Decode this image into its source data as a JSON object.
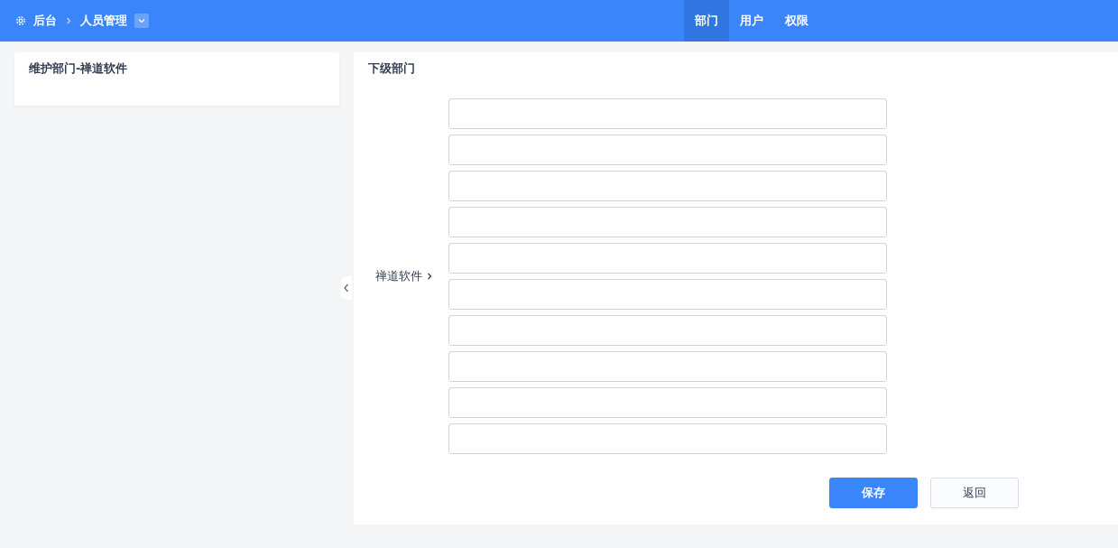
{
  "header": {
    "breadcrumb": [
      {
        "label": "后台"
      },
      {
        "label": "人员管理"
      }
    ],
    "nav": [
      {
        "label": "部门",
        "selected": true
      },
      {
        "label": "用户",
        "selected": false
      },
      {
        "label": "权限",
        "selected": false
      }
    ]
  },
  "sidebar": {
    "title": "维护部门-禅道软件"
  },
  "panel": {
    "title": "下级部门",
    "parent": "禅道软件",
    "fields": [
      {
        "kind": "text"
      },
      {
        "kind": "text"
      },
      {
        "kind": "text"
      },
      {
        "kind": "text"
      },
      {
        "kind": "text"
      },
      {
        "kind": "text"
      },
      {
        "kind": "text"
      },
      {
        "kind": "text"
      },
      {
        "kind": "text"
      },
      {
        "kind": "text"
      }
    ],
    "buttons": [
      {
        "label": "保存",
        "kind": "primary"
      },
      {
        "label": "返回",
        "kind": "default"
      }
    ]
  }
}
